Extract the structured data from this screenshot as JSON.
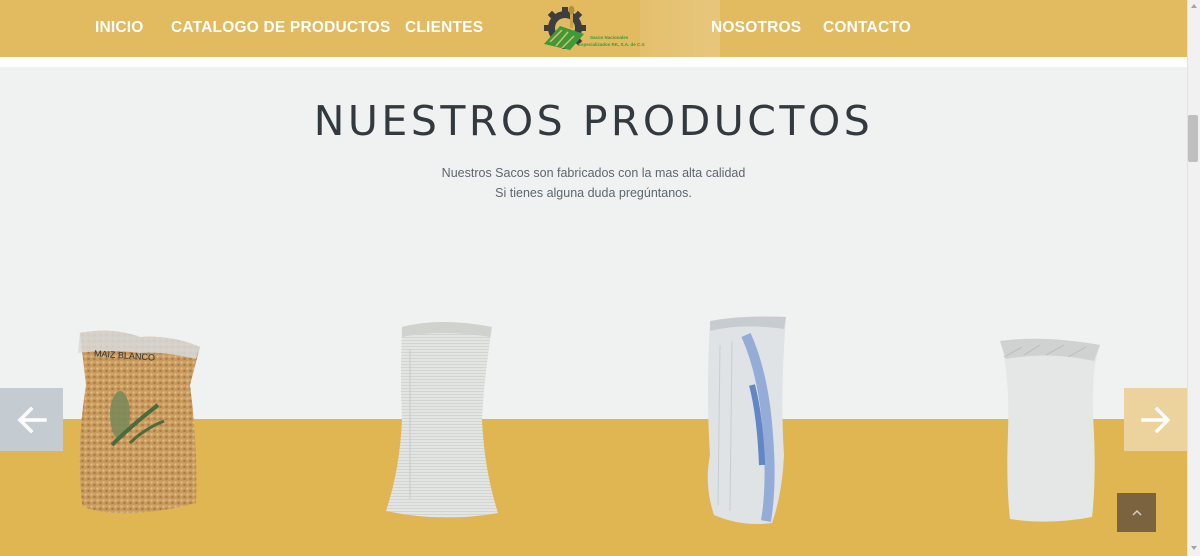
{
  "nav": {
    "left": [
      "INICIO",
      "CATALOGO DE PRODUCTOS",
      "CLIENTES"
    ],
    "right": [
      "NOSOTROS",
      "CONTACTO"
    ]
  },
  "logo": {
    "icon": "gear-wheat-logo-icon",
    "text_line1": "Sacos Nacionales",
    "text_line2": "Especializados RK, S.A. de C.V."
  },
  "section": {
    "title": "NUESTROS PRODUCTOS",
    "subtitle_line1": "Nuestros Sacos son fabricados con la mas alta calidad",
    "subtitle_line2": "Si tienes alguna duda pregúntanos."
  },
  "products": [
    {
      "label": "MAIZ BLANCO",
      "icon": "grain-sack-icon"
    },
    {
      "icon": "white-woven-sack-icon"
    },
    {
      "icon": "transparent-woven-sack-icon"
    },
    {
      "icon": "white-filled-sack-icon"
    }
  ],
  "carousel": {
    "prev_icon": "arrow-left-icon",
    "next_icon": "arrow-right-icon"
  },
  "scroll_top_icon": "chevron-up-icon",
  "colors": {
    "header": "#e2ba60",
    "band": "#e0b653",
    "section_bg": "#f0f1f1",
    "logo_green": "#3b9a3a"
  }
}
